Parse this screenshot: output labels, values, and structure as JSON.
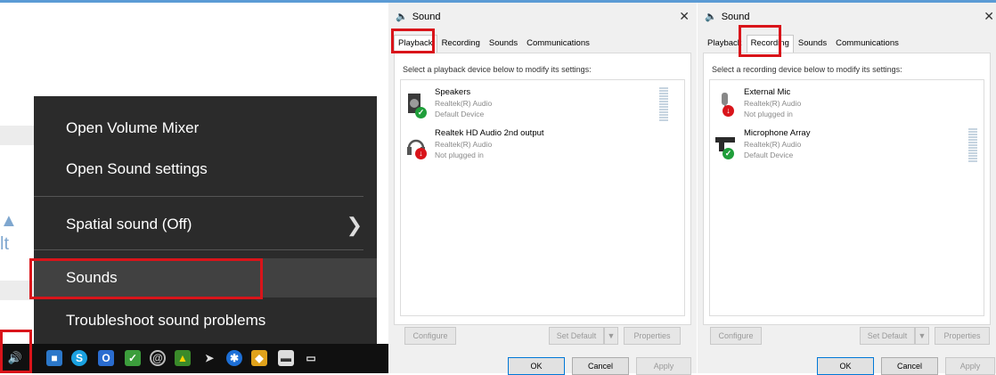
{
  "context_menu": {
    "items": [
      {
        "label": "Open Volume Mixer"
      },
      {
        "label": "Open Sound settings"
      },
      {
        "label": "Spatial sound (Off)"
      },
      {
        "label": "Sounds"
      },
      {
        "label": "Troubleshoot sound problems"
      }
    ]
  },
  "playback_dialog": {
    "title": "Sound",
    "tabs": [
      "Playback",
      "Recording",
      "Sounds",
      "Communications"
    ],
    "instruction": "Select a playback device below to modify its settings:",
    "devices": [
      {
        "name": "Speakers",
        "driver": "Realtek(R) Audio",
        "status": "Default Device"
      },
      {
        "name": "Realtek HD Audio 2nd output",
        "driver": "Realtek(R) Audio",
        "status": "Not plugged in"
      }
    ],
    "buttons": {
      "configure": "Configure",
      "set_default": "Set Default",
      "properties": "Properties",
      "ok": "OK",
      "cancel": "Cancel",
      "apply": "Apply"
    }
  },
  "recording_dialog": {
    "title": "Sound",
    "tabs": [
      "Playback",
      "Recording",
      "Sounds",
      "Communications"
    ],
    "instruction": "Select a recording device below to modify its settings:",
    "devices": [
      {
        "name": "External Mic",
        "driver": "Realtek(R) Audio",
        "status": "Not plugged in"
      },
      {
        "name": "Microphone Array",
        "driver": "Realtek(R) Audio",
        "status": "Default Device"
      }
    ],
    "buttons": {
      "configure": "Configure",
      "set_default": "Set Default",
      "properties": "Properties",
      "ok": "OK",
      "cancel": "Cancel",
      "apply": "Apply"
    }
  },
  "colors": {
    "highlight_red": "#d9141a",
    "menu_bg": "#2b2b2b",
    "taskbar_bg": "#101010",
    "default_green": "#1f9e3a",
    "unplugged_red": "#d9141a"
  }
}
